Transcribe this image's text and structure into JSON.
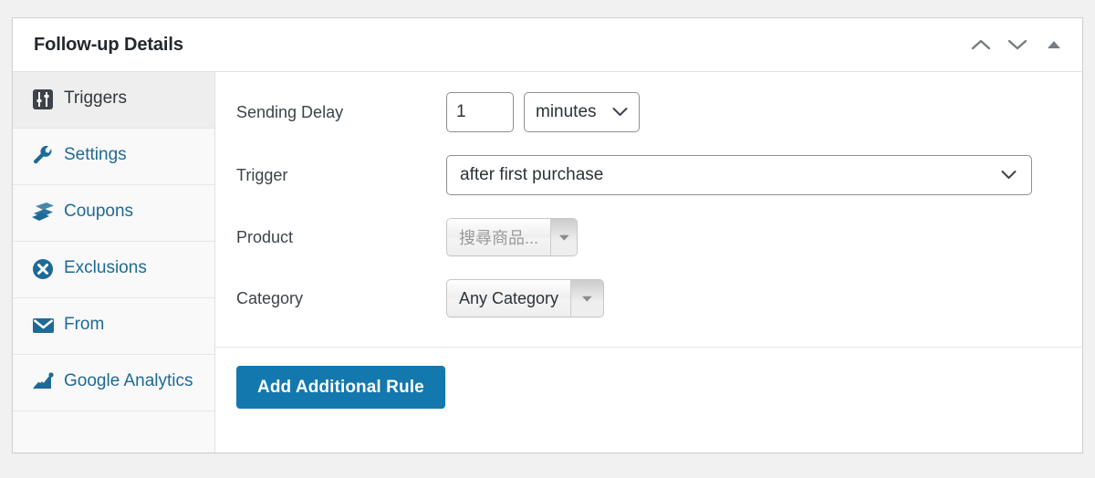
{
  "panel": {
    "title": "Follow-up Details",
    "header_actions": [
      {
        "name": "move-up-button",
        "icon": "chevron-up-icon",
        "label": "Move up"
      },
      {
        "name": "move-down-button",
        "icon": "chevron-down-icon",
        "label": "Move down"
      },
      {
        "name": "toggle-panel-button",
        "icon": "triangle-up-icon",
        "label": "Toggle panel"
      }
    ]
  },
  "sidebar": {
    "items": [
      {
        "label": "Triggers",
        "icon": "sliders-icon",
        "active": true
      },
      {
        "label": "Settings",
        "icon": "wrench-icon",
        "active": false
      },
      {
        "label": "Coupons",
        "icon": "tickets-icon",
        "active": false
      },
      {
        "label": "Exclusions",
        "icon": "x-circle-icon",
        "active": false
      },
      {
        "label": "From",
        "icon": "envelope-icon",
        "active": false
      },
      {
        "label": "Google Analytics",
        "icon": "analytics-chart-icon",
        "active": false
      }
    ]
  },
  "form": {
    "sending_delay": {
      "label": "Sending Delay",
      "value": "1",
      "unit_selected": "minutes"
    },
    "trigger": {
      "label": "Trigger",
      "selected": "after first purchase"
    },
    "product": {
      "label": "Product",
      "placeholder": "搜尋商品...",
      "value": ""
    },
    "category": {
      "label": "Category",
      "selected": "Any Category"
    }
  },
  "actions": {
    "add_rule_label": "Add Additional Rule"
  },
  "colors": {
    "accent": "#1378ae",
    "link": "#1d6a96",
    "panel_bg": "#ffffff",
    "page_bg": "#f1f1f1",
    "sidebar_bg": "#f9f9f9",
    "sidebar_active_bg": "#eeeeee"
  }
}
